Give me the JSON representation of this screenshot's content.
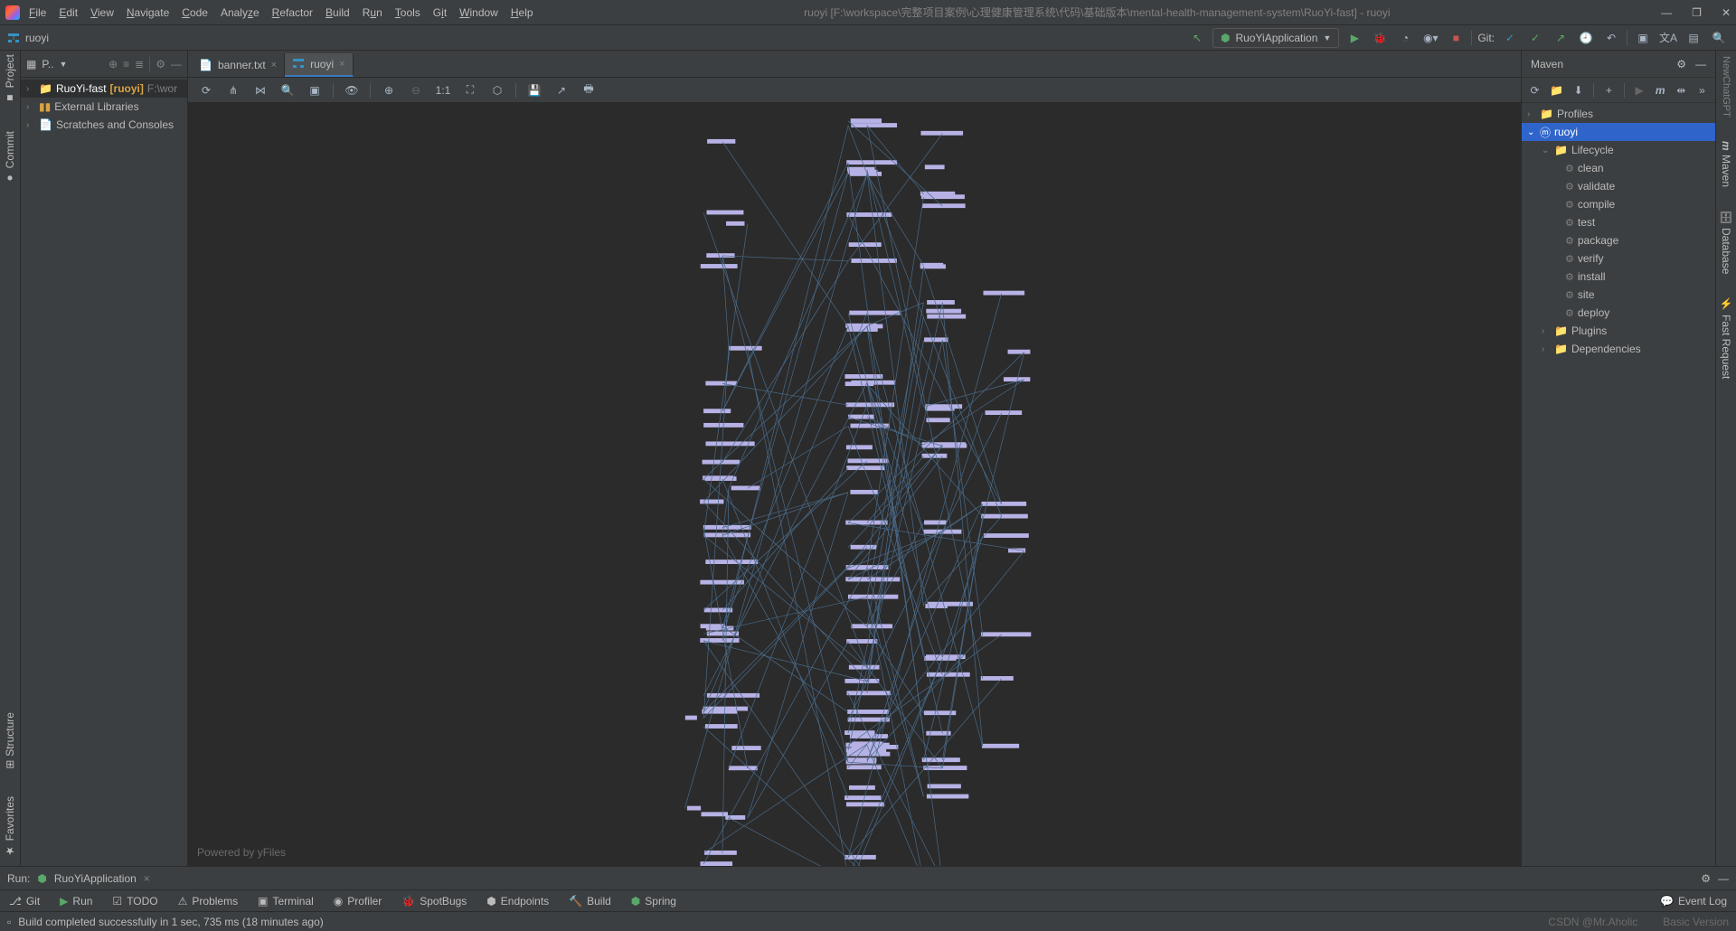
{
  "title": "ruoyi [F:\\workspace\\完整项目案例\\心理健康管理系统\\代码\\基础版本\\mental-health-management-system\\RuoYi-fast] - ruoyi",
  "menu": [
    "File",
    "Edit",
    "View",
    "Navigate",
    "Code",
    "Analyze",
    "Refactor",
    "Build",
    "Run",
    "Tools",
    "Git",
    "Window",
    "Help"
  ],
  "breadcrumb": "ruoyi",
  "run_config": "RuoYiApplication",
  "git_label": "Git:",
  "project_panel": {
    "title_prefix": "P..",
    "root": {
      "name": "RuoYi-fast",
      "suffix": "[ruoyi]",
      "path": "F:\\wor"
    },
    "items": [
      "External Libraries",
      "Scratches and Consoles"
    ]
  },
  "tabs": [
    {
      "label": "banner.txt",
      "active": false
    },
    {
      "label": "ruoyi",
      "active": true
    }
  ],
  "watermark": "Powered by yFiles",
  "maven": {
    "title": "Maven",
    "profiles": "Profiles",
    "root": "ruoyi",
    "lifecycle": "Lifecycle",
    "goals": [
      "clean",
      "validate",
      "compile",
      "test",
      "package",
      "verify",
      "install",
      "site",
      "deploy"
    ],
    "plugins": "Plugins",
    "deps": "Dependencies"
  },
  "left_gutter": [
    "Project",
    "Commit"
  ],
  "left_gutter_bottom": [
    "Structure",
    "Favorites"
  ],
  "right_gutter": [
    "NewChatGPT",
    "Maven",
    "Database",
    "Fast Request"
  ],
  "run_tab": {
    "label": "Run:",
    "config": "RuoYiApplication"
  },
  "bottom_tools": [
    "Git",
    "Run",
    "TODO",
    "Problems",
    "Terminal",
    "Profiler",
    "SpotBugs",
    "Endpoints",
    "Build",
    "Spring"
  ],
  "event_log": "Event Log",
  "status": "Build completed successfully in 1 sec, 735 ms (18 minutes ago)",
  "status_right": "Basic Version",
  "csdn": "CSDN @Mr.Aholic"
}
